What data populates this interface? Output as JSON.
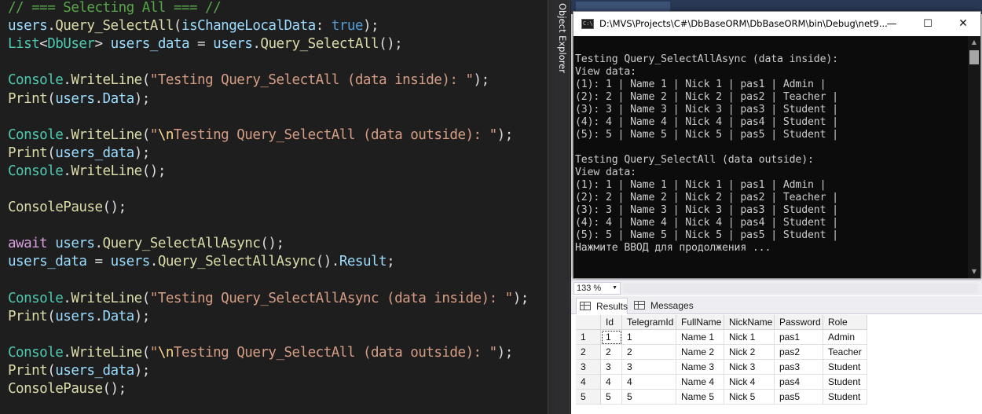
{
  "editor": {
    "lines": [
      [
        {
          "t": "// === Selecting All === //",
          "k": "comment"
        }
      ],
      [
        {
          "t": "users",
          "k": "ident"
        },
        {
          "t": ".",
          "k": "punct"
        },
        {
          "t": "Query_SelectAll",
          "k": "method"
        },
        {
          "t": "(",
          "k": "punct"
        },
        {
          "t": "isChangeLocalData",
          "k": "ident"
        },
        {
          "t": ": ",
          "k": "punct"
        },
        {
          "t": "true",
          "k": "keyword"
        },
        {
          "t": ");",
          "k": "punct"
        }
      ],
      [
        {
          "t": "List",
          "k": "type"
        },
        {
          "t": "<",
          "k": "punct"
        },
        {
          "t": "DbUser",
          "k": "type"
        },
        {
          "t": "> ",
          "k": "punct"
        },
        {
          "t": "users_data",
          "k": "ident"
        },
        {
          "t": " = ",
          "k": "punct"
        },
        {
          "t": "users",
          "k": "ident"
        },
        {
          "t": ".",
          "k": "punct"
        },
        {
          "t": "Query_SelectAll",
          "k": "method"
        },
        {
          "t": "();",
          "k": "punct"
        }
      ],
      [],
      [
        {
          "t": "Console",
          "k": "type"
        },
        {
          "t": ".",
          "k": "punct"
        },
        {
          "t": "WriteLine",
          "k": "method"
        },
        {
          "t": "(",
          "k": "punct"
        },
        {
          "t": "\"Testing Query_SelectAll (data inside): \"",
          "k": "string"
        },
        {
          "t": ");",
          "k": "punct"
        }
      ],
      [
        {
          "t": "Print",
          "k": "method"
        },
        {
          "t": "(",
          "k": "punct"
        },
        {
          "t": "users",
          "k": "ident"
        },
        {
          "t": ".",
          "k": "punct"
        },
        {
          "t": "Data",
          "k": "ident"
        },
        {
          "t": ");",
          "k": "punct"
        }
      ],
      [],
      [
        {
          "t": "Console",
          "k": "type"
        },
        {
          "t": ".",
          "k": "punct"
        },
        {
          "t": "WriteLine",
          "k": "method"
        },
        {
          "t": "(",
          "k": "punct"
        },
        {
          "t": "\"",
          "k": "string"
        },
        {
          "t": "\\n",
          "k": "escape"
        },
        {
          "t": "Testing Query_SelectAll (data outside): \"",
          "k": "string"
        },
        {
          "t": ");",
          "k": "punct"
        }
      ],
      [
        {
          "t": "Print",
          "k": "method"
        },
        {
          "t": "(",
          "k": "punct"
        },
        {
          "t": "users_data",
          "k": "ident"
        },
        {
          "t": ");",
          "k": "punct"
        }
      ],
      [
        {
          "t": "Console",
          "k": "type"
        },
        {
          "t": ".",
          "k": "punct"
        },
        {
          "t": "WriteLine",
          "k": "method"
        },
        {
          "t": "();",
          "k": "punct"
        }
      ],
      [],
      [
        {
          "t": "ConsolePause",
          "k": "method"
        },
        {
          "t": "();",
          "k": "punct"
        }
      ],
      [],
      [
        {
          "t": "await",
          "k": "control"
        },
        {
          "t": " ",
          "k": "punct"
        },
        {
          "t": "users",
          "k": "ident"
        },
        {
          "t": ".",
          "k": "punct"
        },
        {
          "t": "Query_SelectAllAsync",
          "k": "method"
        },
        {
          "t": "();",
          "k": "punct"
        }
      ],
      [
        {
          "t": "users_data",
          "k": "ident"
        },
        {
          "t": " = ",
          "k": "punct"
        },
        {
          "t": "users",
          "k": "ident"
        },
        {
          "t": ".",
          "k": "punct"
        },
        {
          "t": "Query_SelectAllAsync",
          "k": "method"
        },
        {
          "t": "().",
          "k": "punct"
        },
        {
          "t": "Result",
          "k": "ident"
        },
        {
          "t": ";",
          "k": "punct"
        }
      ],
      [],
      [
        {
          "t": "Console",
          "k": "type"
        },
        {
          "t": ".",
          "k": "punct"
        },
        {
          "t": "WriteLine",
          "k": "method"
        },
        {
          "t": "(",
          "k": "punct"
        },
        {
          "t": "\"Testing Query_SelectAllAsync (data inside): \"",
          "k": "string"
        },
        {
          "t": ");",
          "k": "punct"
        }
      ],
      [
        {
          "t": "Print",
          "k": "method"
        },
        {
          "t": "(",
          "k": "punct"
        },
        {
          "t": "users",
          "k": "ident"
        },
        {
          "t": ".",
          "k": "punct"
        },
        {
          "t": "Data",
          "k": "ident"
        },
        {
          "t": ");",
          "k": "punct"
        }
      ],
      [],
      [
        {
          "t": "Console",
          "k": "type"
        },
        {
          "t": ".",
          "k": "punct"
        },
        {
          "t": "WriteLine",
          "k": "method"
        },
        {
          "t": "(",
          "k": "punct"
        },
        {
          "t": "\"",
          "k": "string"
        },
        {
          "t": "\\n",
          "k": "escape"
        },
        {
          "t": "Testing Query_SelectAll (data outside): \"",
          "k": "string"
        },
        {
          "t": ");",
          "k": "punct"
        }
      ],
      [
        {
          "t": "Print",
          "k": "method"
        },
        {
          "t": "(",
          "k": "punct"
        },
        {
          "t": "users_data",
          "k": "ident"
        },
        {
          "t": ");",
          "k": "punct"
        }
      ],
      [
        {
          "t": "ConsolePause",
          "k": "method"
        },
        {
          "t": "();",
          "k": "punct"
        }
      ]
    ]
  },
  "object_explorer": {
    "label": "Object Explorer"
  },
  "console": {
    "title": "D:\\MVS\\Projects\\C#\\DbBaseORM\\DbBaseORM\\bin\\Debug\\net9...",
    "icon_text": "C:\\",
    "minimize_label": "—",
    "maximize_label": "☐",
    "close_label": "✕",
    "lines": [
      "",
      "Testing Query_SelectAllAsync (data inside):",
      "View data:",
      "(1): 1 | Name 1 | Nick 1 | pas1 | Admin |",
      "(2): 2 | Name 2 | Nick 2 | pas2 | Teacher |",
      "(3): 3 | Name 3 | Nick 3 | pas3 | Student |",
      "(4): 4 | Name 4 | Nick 4 | pas4 | Student |",
      "(5): 5 | Name 5 | Nick 5 | pas5 | Student |",
      "",
      "Testing Query_SelectAll (data outside):",
      "View data:",
      "(1): 1 | Name 1 | Nick 1 | pas1 | Admin |",
      "(2): 2 | Name 2 | Nick 2 | pas2 | Teacher |",
      "(3): 3 | Name 3 | Nick 3 | pas3 | Student |",
      "(4): 4 | Name 4 | Nick 4 | pas4 | Student |",
      "(5): 5 | Name 5 | Nick 5 | pas5 | Student |",
      "Нажмите ВВОД для продолжения ..."
    ]
  },
  "zoom": {
    "value": "133 %"
  },
  "results_tabs": {
    "results_label": "Results",
    "messages_label": "Messages"
  },
  "results_grid": {
    "columns": [
      "Id",
      "TelegramId",
      "FullName",
      "NickName",
      "Password",
      "Role"
    ],
    "rows": [
      {
        "num": "1",
        "cells": [
          "1",
          "1",
          "Name 1",
          "Nick 1",
          "pas1",
          "Admin"
        ]
      },
      {
        "num": "2",
        "cells": [
          "2",
          "2",
          "Name 2",
          "Nick 2",
          "pas2",
          "Teacher"
        ]
      },
      {
        "num": "3",
        "cells": [
          "3",
          "3",
          "Name 3",
          "Nick 3",
          "pas3",
          "Student"
        ]
      },
      {
        "num": "4",
        "cells": [
          "4",
          "4",
          "Name 4",
          "Nick 4",
          "pas4",
          "Student"
        ]
      },
      {
        "num": "5",
        "cells": [
          "5",
          "5",
          "Name 5",
          "Nick 5",
          "pas5",
          "Student"
        ]
      }
    ]
  }
}
